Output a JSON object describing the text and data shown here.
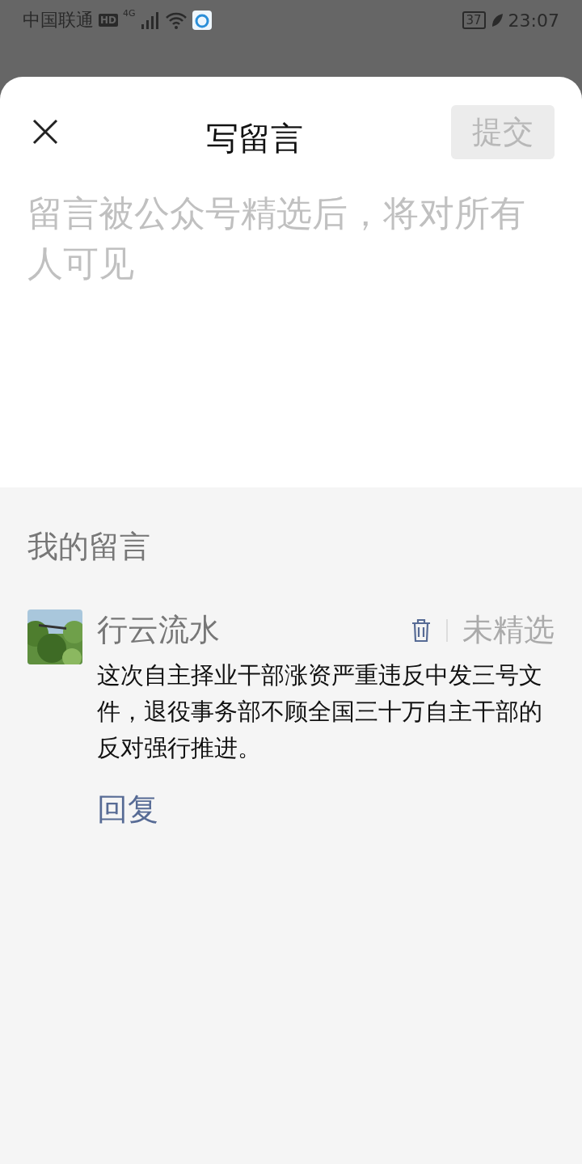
{
  "status_bar": {
    "carrier": "中国联通",
    "hd": "HD",
    "network": "4G",
    "battery": "37",
    "time": "23:07"
  },
  "sheet": {
    "title": "写留言",
    "submit": {
      "label": "提交",
      "disabled": true
    },
    "input": {
      "placeholder": "留言被公众号精选后，将对所有人可见"
    }
  },
  "my_comments": {
    "heading": "我的留言",
    "items": [
      {
        "name": "行云流水",
        "status": "未精选",
        "text": "这次自主择业干部涨资严重违反中发三号文件，退役事务部不顾全国三十万自主干部的反对强行推进。",
        "reply": "回复"
      }
    ]
  }
}
